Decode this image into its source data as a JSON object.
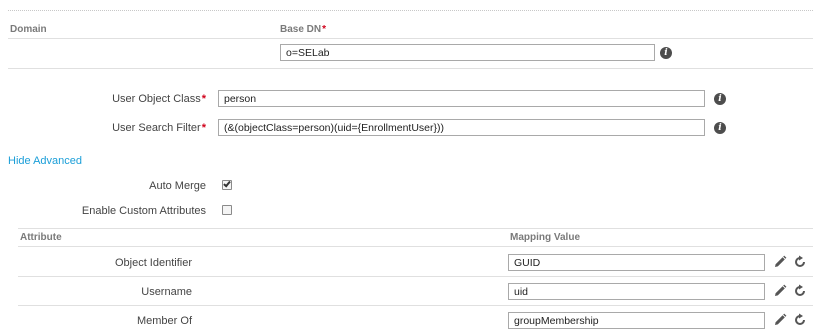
{
  "domain_section": {
    "domain_header": "Domain",
    "base_dn_header": "Base DN",
    "required_mark": "*",
    "base_dn_value": "o=SELab"
  },
  "user_section": {
    "object_class_label": "User Object Class",
    "object_class_value": "person",
    "search_filter_label": "User Search Filter",
    "search_filter_value": "(&(objectClass=person)(uid={EnrollmentUser}))",
    "required_mark": "*"
  },
  "advanced": {
    "toggle_label": "Hide Advanced",
    "auto_merge_label": "Auto Merge",
    "auto_merge_checked": true,
    "custom_attrs_label": "Enable Custom Attributes",
    "custom_attrs_checked": false
  },
  "mapping_table": {
    "attribute_header": "Attribute",
    "mapping_header": "Mapping Value",
    "rows": [
      {
        "attribute": "Object Identifier",
        "value": "GUID"
      },
      {
        "attribute": "Username",
        "value": "uid"
      },
      {
        "attribute": "Member Of",
        "value": "groupMembership"
      }
    ]
  },
  "icons": {
    "info": "info-icon",
    "edit": "pencil-icon",
    "reset": "refresh-icon"
  },
  "colors": {
    "required": "#d0021b",
    "link": "#1a9ed8",
    "info_icon": "#4d4d4d"
  }
}
